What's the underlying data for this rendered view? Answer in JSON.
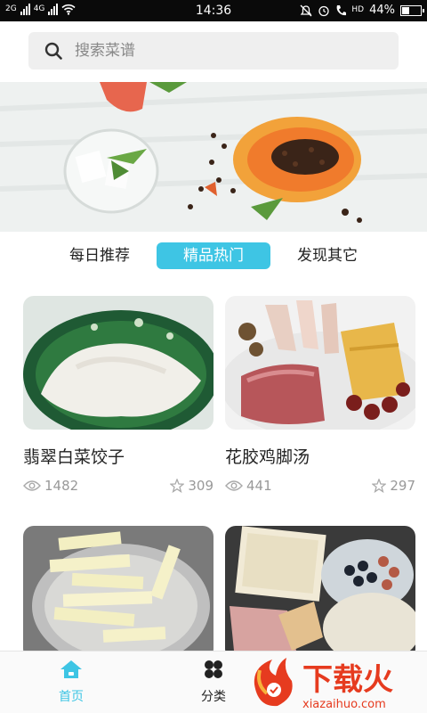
{
  "status_bar": {
    "signal_left": "2G",
    "signal_right": "4G",
    "time": "14:36",
    "volte": "HD",
    "battery": "44%",
    "battery_level": 0.44
  },
  "search": {
    "placeholder": "搜索菜谱"
  },
  "tabs": [
    {
      "label": "每日推荐",
      "active": false
    },
    {
      "label": "精品热门",
      "active": true
    },
    {
      "label": "发现其它",
      "active": false
    }
  ],
  "recipes": [
    {
      "title": "翡翠白菜饺子",
      "views": "1482",
      "favorites": "309"
    },
    {
      "title": "花胶鸡脚汤",
      "views": "441",
      "favorites": "297"
    },
    {
      "title": "",
      "views": "",
      "favorites": ""
    },
    {
      "title": "",
      "views": "",
      "favorites": ""
    }
  ],
  "bottom_nav": [
    {
      "label": "首页",
      "active": true,
      "icon": "home-icon"
    },
    {
      "label": "分类",
      "active": false,
      "icon": "category-icon"
    }
  ],
  "watermark": {
    "brand": "下载火",
    "site": "xiazaihuo.com"
  },
  "colors": {
    "accent": "#3ec5e4",
    "watermark": "#e63b1f"
  }
}
